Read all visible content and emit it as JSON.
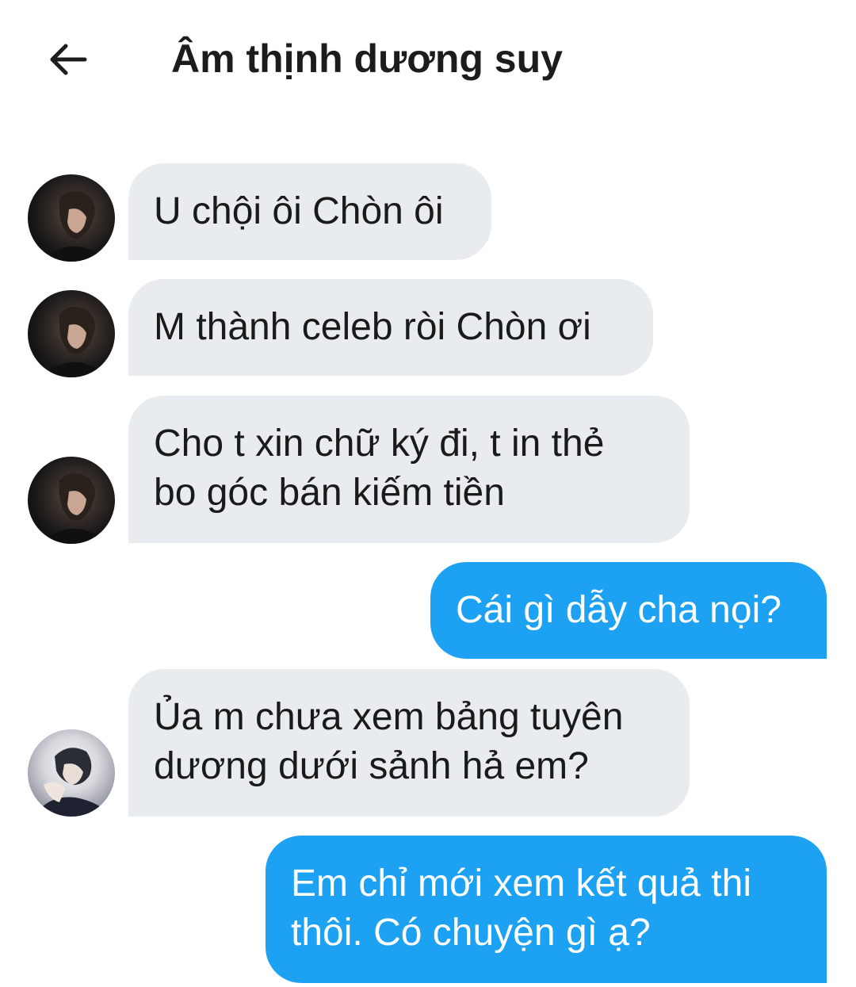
{
  "header": {
    "back_icon": "arrow-left-icon",
    "title": "Âm thịnh dương suy"
  },
  "messages": [
    {
      "direction": "incoming",
      "text": "U chội ôi Chòn ôi"
    },
    {
      "direction": "incoming",
      "text": "M thành celeb ròi Chòn ơi"
    },
    {
      "direction": "incoming",
      "text": "Cho t xin chữ ký đi, t in thẻ bo góc bán kiếm tiền"
    },
    {
      "direction": "outgoing",
      "text": "Cái gì dẫy cha nọi?"
    },
    {
      "direction": "incoming",
      "text": "Ủa m chưa xem bảng tuyên dương dưới sảnh hả em?"
    },
    {
      "direction": "outgoing",
      "text": "Em chỉ mới xem kết quả thi thôi. Có chuyện gì ạ?"
    }
  ],
  "colors": {
    "incoming_bubble": "#e8ecef",
    "outgoing_bubble": "#1da1f2",
    "text_dark": "#1a1a1a",
    "text_light": "#ffffff"
  }
}
